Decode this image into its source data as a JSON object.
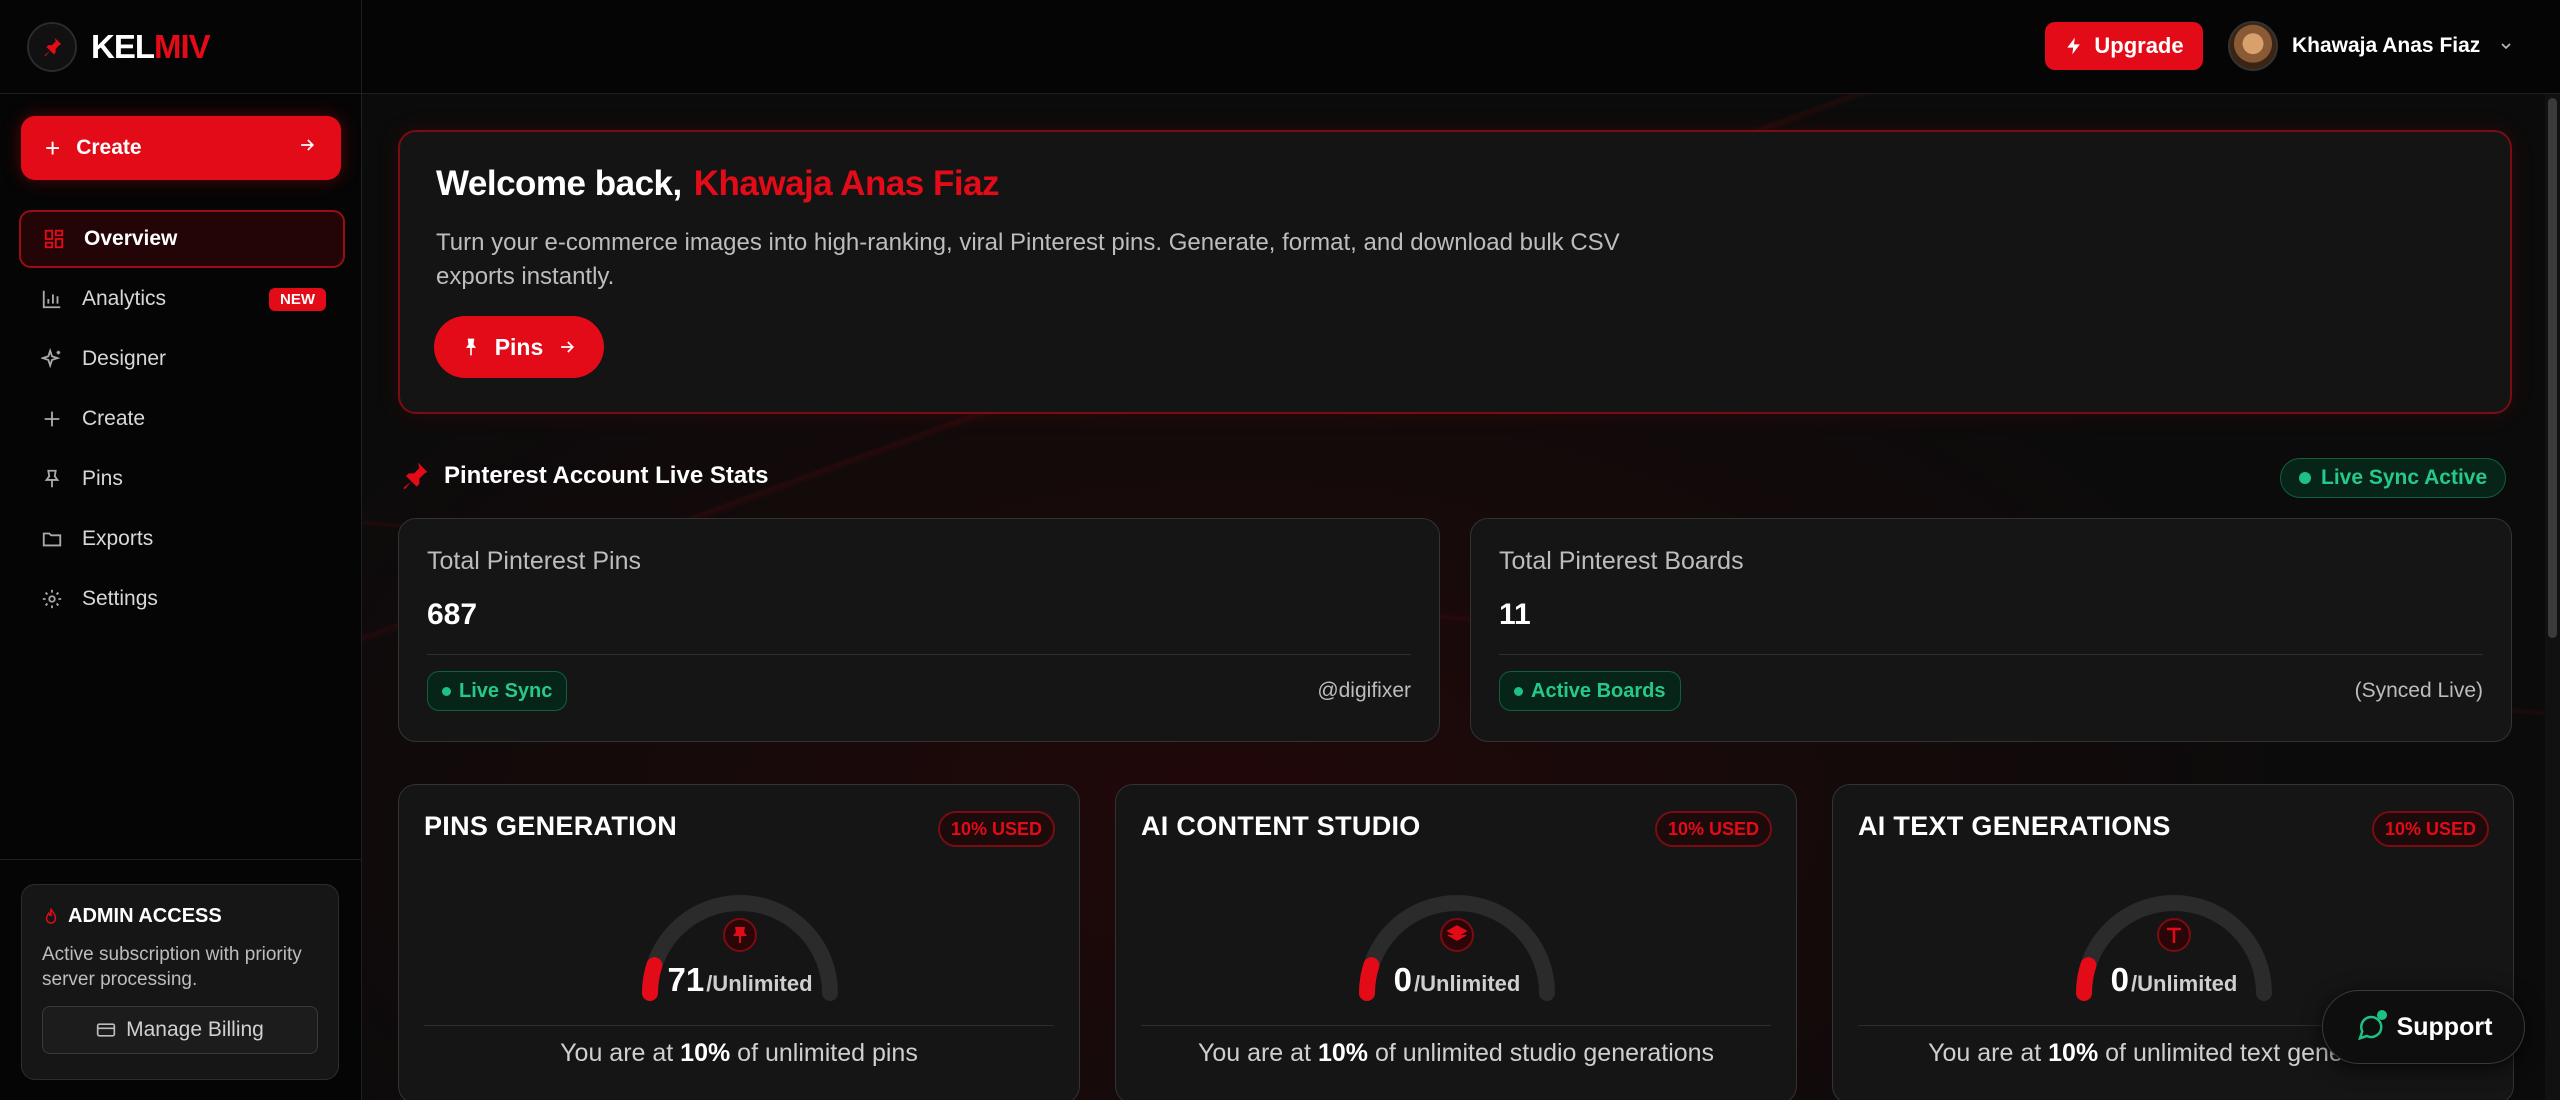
{
  "brand": {
    "name_a": "KEL",
    "name_b": "MIV"
  },
  "sidebar": {
    "create_label": "Create",
    "items": [
      {
        "label": "Overview",
        "icon": "grid-icon",
        "active": true
      },
      {
        "label": "Analytics",
        "icon": "bar-chart-icon",
        "badge": "NEW"
      },
      {
        "label": "Designer",
        "icon": "sparkles-icon"
      },
      {
        "label": "Create",
        "icon": "plus-icon"
      },
      {
        "label": "Pins",
        "icon": "pin-icon"
      },
      {
        "label": "Exports",
        "icon": "folder-icon"
      },
      {
        "label": "Settings",
        "icon": "gear-icon"
      }
    ],
    "admin": {
      "title": "ADMIN ACCESS",
      "description": "Active subscription with priority server processing.",
      "billing_label": "Manage Billing"
    }
  },
  "header": {
    "upgrade_label": "Upgrade",
    "user_name": "Khawaja Anas Fiaz"
  },
  "hero": {
    "greeting": "Welcome back,",
    "name": "Khawaja Anas Fiaz",
    "description": "Turn your e-commerce images into high-ranking, viral Pinterest pins. Generate, format, and download bulk CSV exports instantly.",
    "button_label": "Pins"
  },
  "stats": {
    "heading": "Pinterest Account Live Stats",
    "sync_status": "Live Sync Active",
    "cards": [
      {
        "label": "Total Pinterest Pins",
        "value": "687",
        "pill": "Live Sync",
        "meta": "@digifixer"
      },
      {
        "label": "Total Pinterest Boards",
        "value": "11",
        "pill": "Active Boards",
        "meta": "(Synced Live)"
      }
    ]
  },
  "usage": [
    {
      "title": "PINS GENERATION",
      "used": "10% USED",
      "percent": 10,
      "value": "71",
      "unit": "/Unlimited",
      "icon": "pin-icon",
      "foot_pre": "You are at",
      "foot_pct": "10%",
      "foot_post": "of unlimited pins"
    },
    {
      "title": "AI CONTENT STUDIO",
      "used": "10% USED",
      "percent": 10,
      "value": "0",
      "unit": "/Unlimited",
      "icon": "layers-icon",
      "foot_pre": "You are at",
      "foot_pct": "10%",
      "foot_post": "of unlimited studio generations"
    },
    {
      "title": "AI TEXT GENERATIONS",
      "used": "10% USED",
      "percent": 10,
      "value": "0",
      "unit": "/Unlimited",
      "icon": "text-icon",
      "foot_pre": "You are at",
      "foot_pct": "10%",
      "foot_post": "of unlimited text generations"
    }
  ],
  "support_label": "Support",
  "colors": {
    "accent": "#e30b17",
    "success": "#27c98a",
    "background": "#050505"
  }
}
